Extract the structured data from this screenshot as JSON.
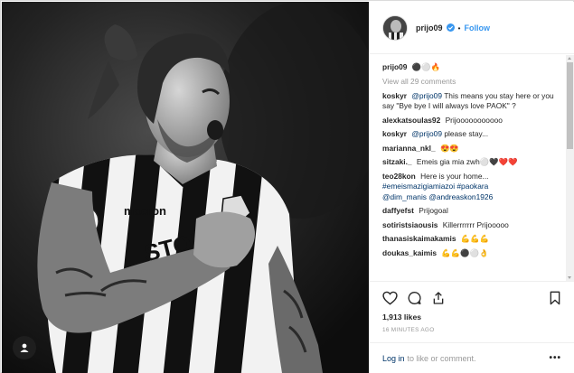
{
  "post": {
    "username": "prijo09",
    "follow_label": "Follow",
    "separator": "•",
    "caption_emoji": "⚫⚪🔥",
    "view_all": "View all 29 comments",
    "likes": "1,913 likes",
    "timestamp": "16 MINUTES AGO",
    "login_link": "Log in",
    "login_text": "to like or comment.",
    "more": "•••"
  },
  "comments": [
    {
      "user": "koskyr",
      "mention": "@prijo09",
      "text": "This means you stay here or you say \"Bye bye I will always love PAOK\" ?"
    },
    {
      "user": "alexkatsoulas92",
      "mention": "",
      "text": "Prijooooooooooo"
    },
    {
      "user": "koskyr",
      "mention": "@prijo09",
      "text": "please stay..."
    },
    {
      "user": "marianna_nkl_",
      "mention": "",
      "text": "😍😍"
    },
    {
      "user": "sitzaki._",
      "mention": "",
      "text": "Emeis gia mia zwh⚪🖤❤️❤️"
    },
    {
      "user": "teo28kon",
      "mention": "",
      "text": "Here is your home...",
      "tags": "#emeismazigiamiazoi #paokara",
      "tags2": "@dim_manis @andreaskon1926"
    },
    {
      "user": "daffyefst",
      "mention": "",
      "text": "Prijogoal"
    },
    {
      "user": "sotiristsiaousis",
      "mention": "",
      "text": "Killerrrrrrr Prijooooo"
    },
    {
      "user": "thanasiskaimakamis",
      "mention": "",
      "text": "💪💪💪"
    },
    {
      "user": "doukas_kaimis",
      "mention": "",
      "text": "💪💪⚫⚪👌"
    }
  ],
  "icons": {
    "verified": "verified-badge-icon",
    "like": "heart-icon",
    "comment": "comment-bubble-icon",
    "share": "share-icon",
    "save": "bookmark-icon",
    "user_tag": "user-tag-icon"
  },
  "colors": {
    "link": "#003569",
    "follow": "#3897f0",
    "muted": "#999999"
  },
  "photo_text": {
    "sponsor": "STOIX",
    "kit_brand": "macron"
  }
}
